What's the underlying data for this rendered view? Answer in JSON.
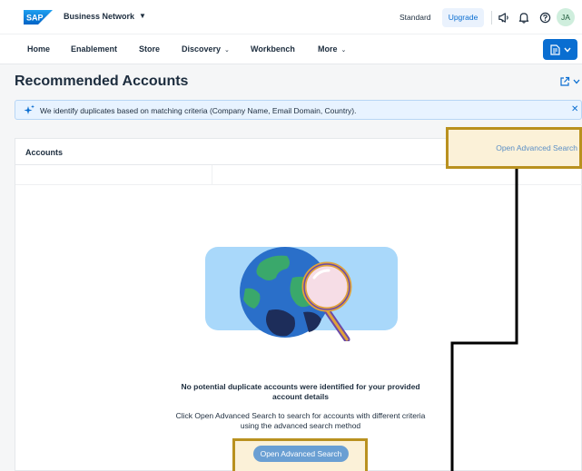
{
  "shell": {
    "logo_text": "SAP",
    "product_name": "Business Network",
    "product_caret": "▼",
    "standard_label": "Standard",
    "upgrade_label": "Upgrade",
    "avatar_initials": "JA"
  },
  "nav": {
    "items": [
      {
        "label": "Home"
      },
      {
        "label": "Enablement"
      },
      {
        "label": "Store"
      },
      {
        "label": "Discovery",
        "caret": "⌄"
      },
      {
        "label": "Workbench"
      },
      {
        "label": "More",
        "caret": "⌄"
      }
    ]
  },
  "page": {
    "title": "Recommended Accounts"
  },
  "info": {
    "message": "We identify duplicates based on matching criteria (Company Name, Email Domain, Country).",
    "close": "✕"
  },
  "panel": {
    "title": "Accounts",
    "advanced_search_link": "Open Advanced Search"
  },
  "empty_state": {
    "title_line1": "No potential duplicate accounts were identified for your provided",
    "title_line2": "account details",
    "desc_line1": "Click Open Advanced Search to search for accounts with different criteria",
    "desc_line2": "using the advanced search method",
    "button_label": "Open Advanced Search"
  },
  "colors": {
    "accent": "#0a6ed1",
    "highlight_border": "#b9911f",
    "highlight_fill": "#fbf1d8",
    "info_bg": "#e8f3ff"
  }
}
